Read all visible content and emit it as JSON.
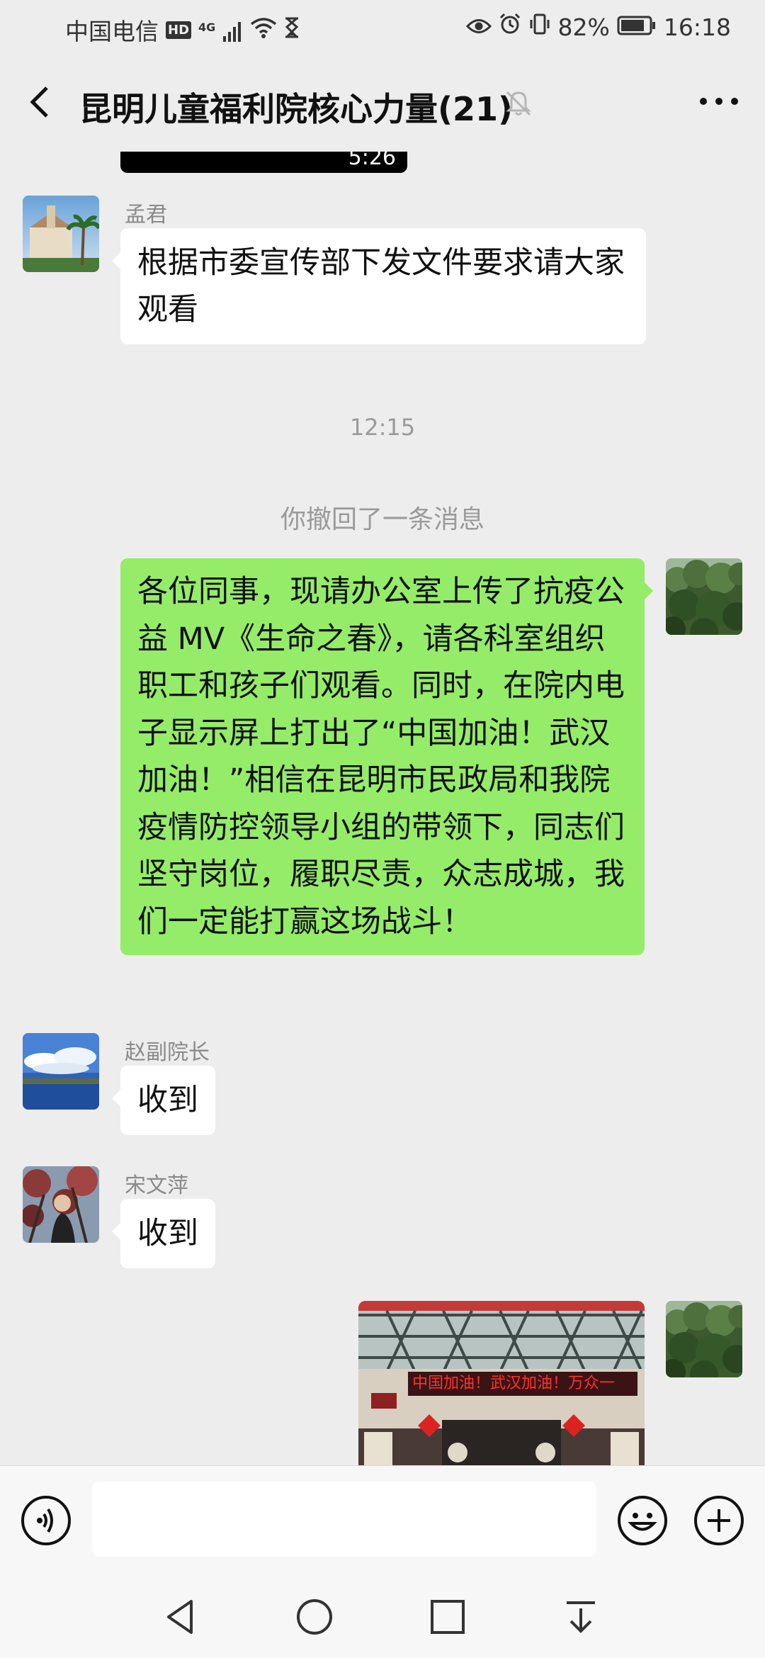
{
  "status_bar": {
    "carrier": "中国电信",
    "hd": "HD",
    "network": "4G",
    "battery": "82%",
    "time": "16:18"
  },
  "title_bar": {
    "title": "昆明儿童福利院核心力量(21)"
  },
  "chat": {
    "video_duration": "5:26",
    "msg1": {
      "sender": "孟君",
      "text": "根据市委宣传部下发文件要求请大家观看"
    },
    "timestamp": "12:15",
    "recall_notice": "你撤回了一条消息",
    "msg2": {
      "text": "各位同事，现请办公室上传了抗疫公益 MV《生命之春》，请各科室组织职工和孩子们观看。同时，在院内电子显示屏上打出了“中国加油！武汉加油！”相信在昆明市民政局和我院疫情防控领导小组的带领下，同志们坚守岗位，履职尽责，众志成城，我们一定能打赢这场战斗！"
    },
    "msg3": {
      "sender": "赵副院长",
      "text": "收到"
    },
    "msg4": {
      "sender": "宋文萍",
      "text": "收到"
    },
    "msg5": {
      "image_banner_text": "中国加油！武汉加油！万众一"
    }
  },
  "input_bar": {
    "placeholder": ""
  },
  "colors": {
    "background": "#ededed",
    "bubble_self": "#95ec69",
    "bubble_other": "#ffffff",
    "led_banner": "#b22222"
  }
}
